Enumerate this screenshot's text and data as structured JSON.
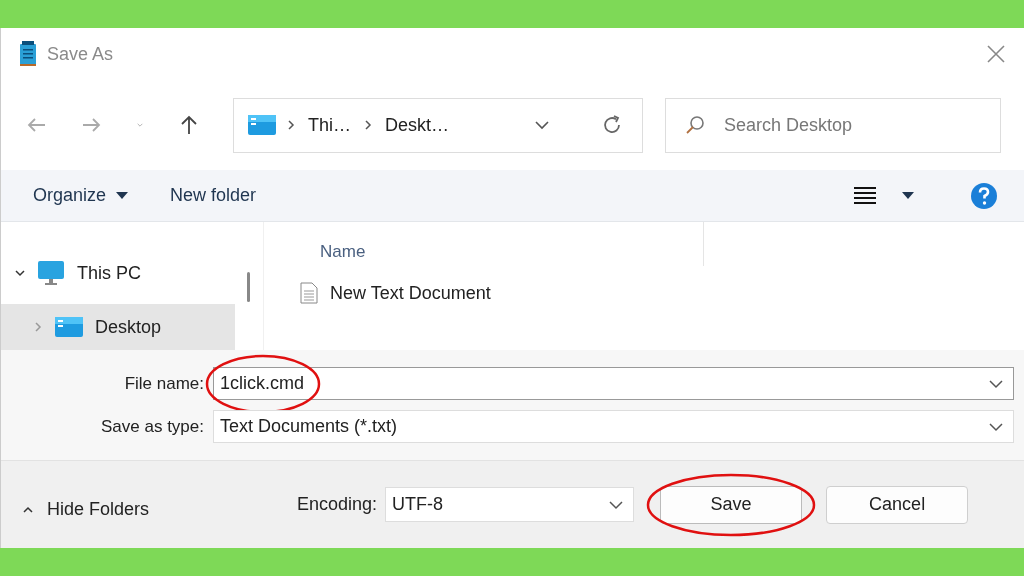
{
  "window": {
    "title": "Save As"
  },
  "nav": {
    "breadcrumb": [
      {
        "label": "Thi…"
      },
      {
        "label": "Deskt…"
      }
    ],
    "search": {
      "placeholder": "Search Desktop"
    }
  },
  "toolbar": {
    "items": [
      {
        "label": "Organize",
        "kind": "menu"
      },
      {
        "label": "New folder",
        "kind": "button"
      }
    ]
  },
  "sidebar": {
    "items": [
      {
        "label": "This PC",
        "expanded": true,
        "selected": false,
        "children": [
          {
            "label": "Desktop",
            "expanded": false,
            "selected": true
          }
        ]
      }
    ]
  },
  "file_list": {
    "columns": [
      "Name"
    ],
    "rows": [
      {
        "name": "New Text Document"
      }
    ]
  },
  "form": {
    "file_name": {
      "label": "File name:",
      "value": "1click.cmd",
      "circled": true
    },
    "save_as_type": {
      "label": "Save as type:",
      "value": "Text Documents (*.txt)"
    }
  },
  "footer": {
    "hide_folders": "Hide Folders",
    "encoding": {
      "label": "Encoding:",
      "value": "UTF-8"
    },
    "buttons": [
      {
        "label": "Save",
        "kind": "primary",
        "circled": true
      },
      {
        "label": "Cancel",
        "kind": "secondary",
        "circled": false
      }
    ]
  }
}
